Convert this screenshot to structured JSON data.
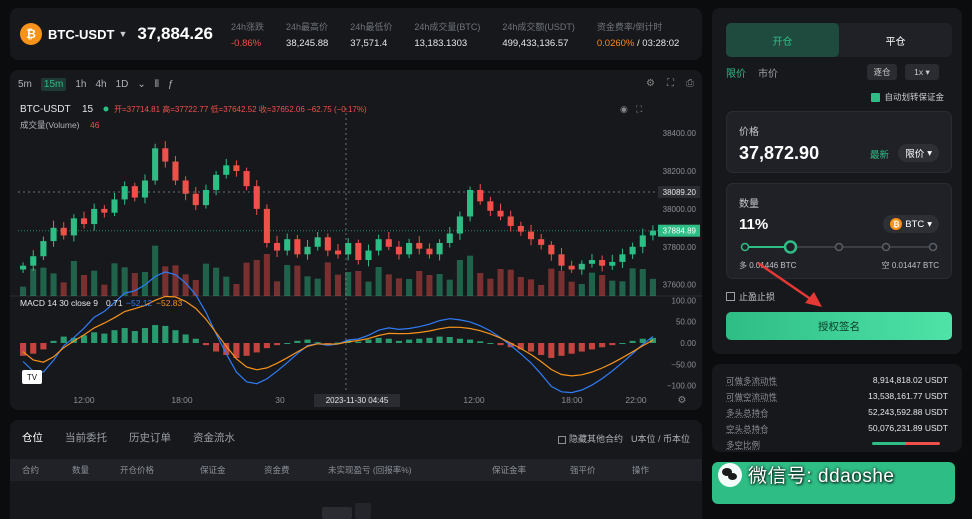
{
  "ticker": {
    "coin_glyph": "₿",
    "pair": "BTC-USDT",
    "price": "37,884.26",
    "stats": [
      {
        "label": "24h涨跌",
        "value": "-0.86%",
        "tone": "red"
      },
      {
        "label": "24h最高价",
        "value": "38,245.88",
        "tone": "normal"
      },
      {
        "label": "24h最低价",
        "value": "37,571.4",
        "tone": "normal"
      },
      {
        "label": "24h成交量(BTC)",
        "value": "13,183.1303",
        "tone": "normal"
      },
      {
        "label": "24h成交额(USDT)",
        "value": "499,433,136.57",
        "tone": "normal"
      },
      {
        "label": "资金费率/倒计时",
        "value": "0.0260%",
        "value2": "03:28:02",
        "tone": "orange"
      }
    ]
  },
  "chart": {
    "toolbar": {
      "timeframes": [
        "5m",
        "15m",
        "1h",
        "4h",
        "1D"
      ],
      "active_timeframe": "15m",
      "caret": "⌄",
      "tools": [
        "⫴",
        "ƒ"
      ],
      "right_icons": [
        "⚙",
        "⛶",
        "⎙"
      ]
    },
    "legend": {
      "symbol": "BTC-USDT",
      "interval": "15",
      "ohlc_text": "开=37714.81 高=37722.77 低=37642.52 收=37652.06 −62.75 (−0.17%)",
      "volume_label": "成交量(Volume)",
      "volume_value": "46"
    },
    "macd_legend": {
      "label": "MACD 14 30 close 9",
      "v1": "0.71",
      "v2": "−52.12",
      "v3": "−52.83"
    },
    "logo": "TV",
    "gear_glyph": "⚙"
  },
  "chart_data": {
    "type": "candlestick",
    "price_axis": {
      "ticks": [
        "38400.00",
        "38200.00",
        "38000.00",
        "37800.00",
        "37600.00"
      ],
      "ylim": [
        37540,
        38480
      ],
      "crosshair_label": "38089.20",
      "current_label": "37884.89",
      "current_value": 37884.89,
      "crosshair_value": 38089.2
    },
    "macd_axis": {
      "ticks": [
        "100.00",
        "50.00",
        "0.00",
        "−50.00",
        "−100.00"
      ],
      "ylim": [
        -110,
        110
      ]
    },
    "time_axis": {
      "labels": [
        "12:00",
        "18:00",
        "30",
        "12:00",
        "18:00",
        "22:00"
      ],
      "crosshair_label": "2023-11-30   04:45"
    },
    "price_path": [
      37700,
      37750,
      37830,
      37900,
      37860,
      37950,
      37920,
      38000,
      37980,
      38050,
      38120,
      38060,
      38150,
      38320,
      38250,
      38150,
      38080,
      38020,
      38100,
      38180,
      38230,
      38200,
      38120,
      38000,
      37820,
      37780,
      37840,
      37760,
      37800,
      37850,
      37780,
      37760,
      37820,
      37730,
      37780,
      37840,
      37800,
      37760,
      37820,
      37790,
      37760,
      37820,
      37870,
      37960,
      38100,
      38040,
      37990,
      37960,
      37910,
      37880,
      37840,
      37810,
      37760,
      37700,
      37680,
      37710,
      37730,
      37700,
      37720,
      37760,
      37800,
      37860,
      37885
    ],
    "macd_hist": [
      -30,
      -25,
      -15,
      5,
      15,
      12,
      18,
      25,
      22,
      30,
      35,
      28,
      35,
      42,
      40,
      30,
      20,
      10,
      -5,
      -20,
      -28,
      -35,
      -30,
      -22,
      -12,
      -5,
      0,
      5,
      8,
      2,
      -3,
      1,
      6,
      3,
      8,
      12,
      10,
      5,
      8,
      10,
      12,
      15,
      14,
      10,
      8,
      4,
      0,
      -5,
      -10,
      -15,
      -20,
      -28,
      -35,
      -30,
      -25,
      -20,
      -15,
      -10,
      -5,
      0,
      5,
      10,
      12
    ]
  },
  "positions": {
    "tabs": [
      "仓位",
      "当前委托",
      "历史订单",
      "资金流水"
    ],
    "hide_other": "隐藏其他合约",
    "unit_toggle": "U本位 / 币本位",
    "headers": [
      "合约",
      "数量",
      "开仓价格",
      "保证金",
      "资金费",
      "未实现盈亏 (回报率%)",
      "保证金率",
      "强平价",
      "操作"
    ]
  },
  "order": {
    "tabs": [
      "开仓",
      "平仓"
    ],
    "active_tab": "开仓",
    "types": [
      "限价",
      "市价"
    ],
    "active_type": "限价",
    "mode": "逐仓",
    "leverage": "1x",
    "auto_margin": "自动划转保证金",
    "price_label": "价格",
    "price": "37,872.90",
    "latest": "最新",
    "limit_pill": "限价",
    "qty_label": "数量",
    "qty_pct": "11%",
    "qty_coin": "BTC",
    "qty_coin_glyph": "₿",
    "slider_value": 0.11,
    "long_qty": "多 0.01446 BTC",
    "short_qty": "空 0.01447 BTC",
    "stop_label": "止盈止损",
    "auth_button": "授权签名"
  },
  "account": {
    "rows": [
      {
        "k": "可做多流动性",
        "v": "8,914,818.02 USDT"
      },
      {
        "k": "可做空流动性",
        "v": "13,538,161.77 USDT"
      },
      {
        "k": "多头总持仓",
        "v": "52,243,592.88 USDT"
      },
      {
        "k": "空头总持仓",
        "v": "50,076,231.89 USDT"
      },
      {
        "k": "多空比例",
        "v": ""
      }
    ]
  },
  "watermark": {
    "text": "微信号: ddaoshe"
  },
  "colors": {
    "up": "#2ebd85",
    "down": "#f0504a",
    "orange": "#f78b1f",
    "macd_fast": "#2f7cf6",
    "macd_slow": "#f7931a"
  }
}
